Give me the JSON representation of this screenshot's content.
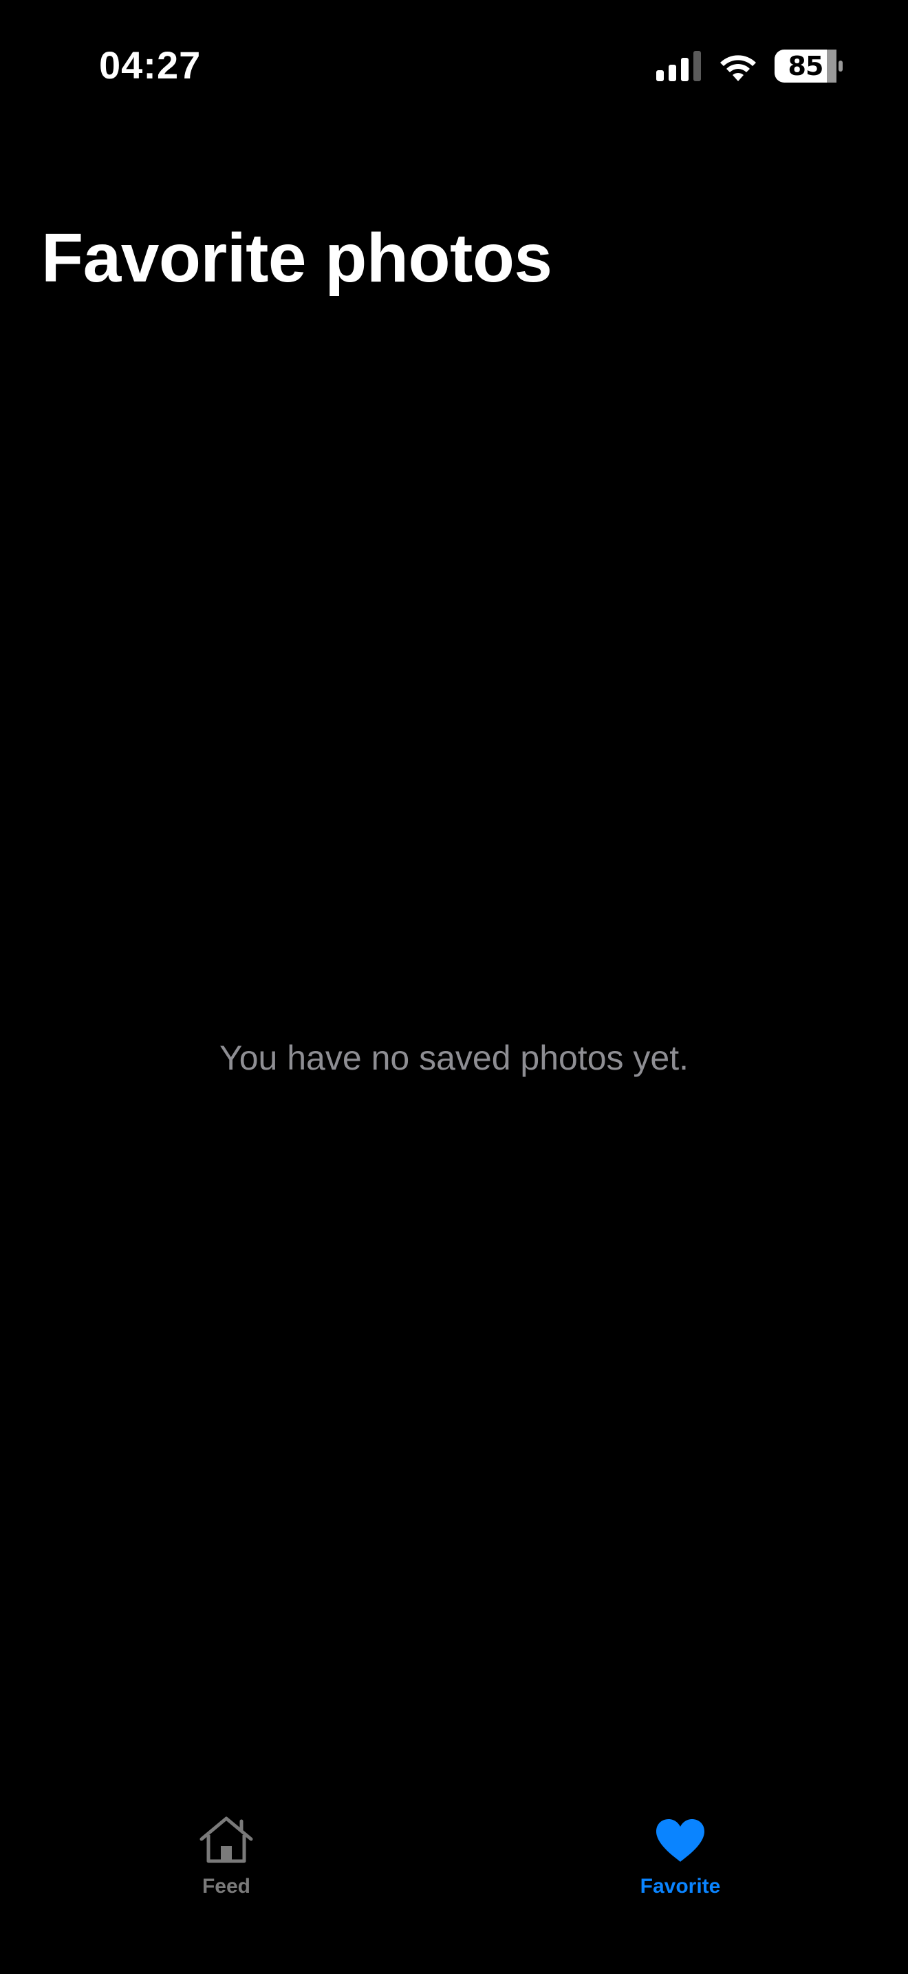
{
  "status_bar": {
    "time": "04:27",
    "battery_level": "85",
    "icons": [
      "cellular-signal-icon",
      "wifi-icon",
      "battery-icon"
    ]
  },
  "page": {
    "title": "Favorite photos",
    "empty_message": "You have no saved photos yet."
  },
  "tab_bar": {
    "tabs": [
      {
        "label": "Feed",
        "icon": "house-icon",
        "selected": false
      },
      {
        "label": "Favorite",
        "icon": "heart-icon",
        "selected": true
      }
    ]
  },
  "colors": {
    "background": "#000000",
    "accent": "#0a84ff",
    "inactive": "#7a7a7a",
    "secondary_text": "#8e8e93"
  }
}
